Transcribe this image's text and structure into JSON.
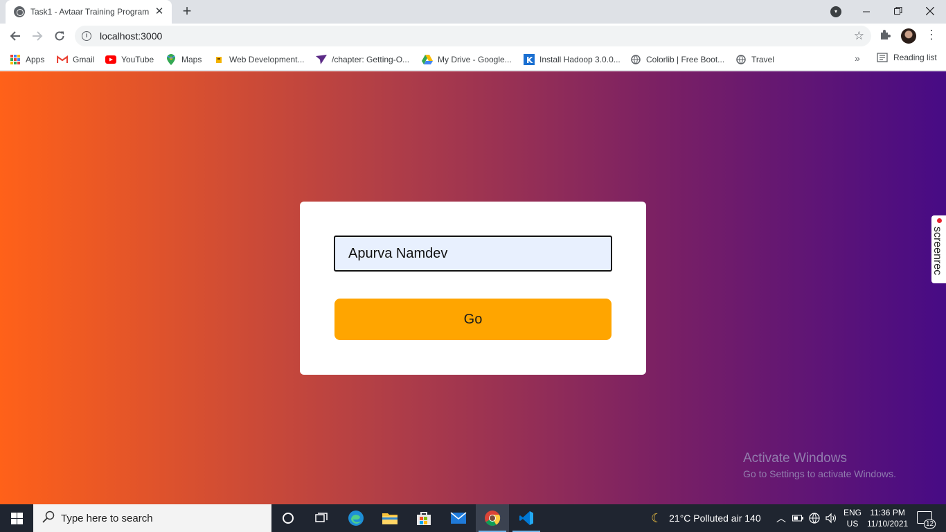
{
  "browser": {
    "tab_title": "Task1 - Avtaar Training Program",
    "tab_close": "✕",
    "new_tab": "+",
    "url": "localhost:3000",
    "bookmarks": [
      {
        "label": "Apps",
        "icon": "apps-grid-icon"
      },
      {
        "label": "Gmail",
        "icon": "gmail-icon"
      },
      {
        "label": "YouTube",
        "icon": "youtube-icon"
      },
      {
        "label": "Maps",
        "icon": "maps-icon"
      },
      {
        "label": "Web Development...",
        "icon": "folder-icon"
      },
      {
        "label": "/chapter: Getting-O...",
        "icon": "bookmark-icon"
      },
      {
        "label": "My Drive - Google...",
        "icon": "google-drive-icon"
      },
      {
        "label": "Install Hadoop 3.0.0...",
        "icon": "k-icon"
      },
      {
        "label": "Colorlib | Free Boot...",
        "icon": "globe-icon"
      },
      {
        "label": "Travel",
        "icon": "globe-icon"
      }
    ],
    "more_bookmarks": "»",
    "reading_list": "Reading list"
  },
  "page": {
    "name_input_value": "Apurva Namdev",
    "go_button_label": "Go",
    "gradient_colors": [
      "#ff6119",
      "#b23f46",
      "#7a2064",
      "#470b85"
    ],
    "button_color": "#ffa500"
  },
  "overlay": {
    "watermark_title": "Activate Windows",
    "watermark_subtitle": "Go to Settings to activate Windows.",
    "screenrec_label": "screenrec"
  },
  "taskbar": {
    "search_placeholder": "Type here to search",
    "weather": "21°C  Polluted air 140",
    "lang_line1": "ENG",
    "lang_line2": "US",
    "time": "11:36 PM",
    "date": "11/10/2021",
    "notification_count": "12"
  }
}
